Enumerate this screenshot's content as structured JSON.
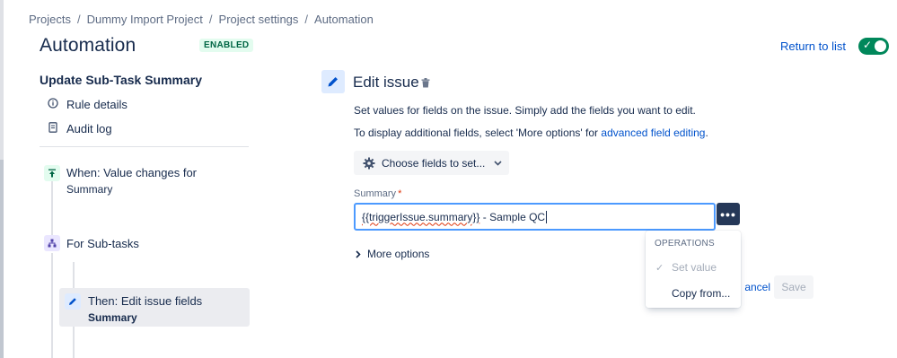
{
  "breadcrumb": {
    "items": [
      "Projects",
      "Dummy Import Project",
      "Project settings",
      "Automation"
    ],
    "separator": "/"
  },
  "header": {
    "title": "Automation",
    "status_badge": "ENABLED",
    "return_link": "Return to list",
    "toggle_on": true
  },
  "sidebar": {
    "rule_name": "Update Sub-Task Summary",
    "links": [
      {
        "label": "Rule details",
        "icon": "info-icon"
      },
      {
        "label": "Audit log",
        "icon": "document-icon"
      }
    ],
    "trigger": {
      "label": "When: Value changes for",
      "sub": "Summary"
    },
    "branch": {
      "label": "For Sub-tasks"
    },
    "action": {
      "label": "Then: Edit issue fields",
      "sub": "Summary"
    }
  },
  "editor": {
    "title": "Edit issue",
    "desc1": "Set values for fields on the issue. Simply add the fields you want to edit.",
    "desc2_prefix": "To display additional fields, select 'More options' for ",
    "desc2_link": "advanced field editing",
    "desc2_suffix": ".",
    "choose_button": "Choose fields to set...",
    "field_label": "Summary",
    "required_mark": "*",
    "field_value_smart": "{{triggerIssue.summary}}",
    "field_value_rest": " - Sample QC",
    "more_button": "•••",
    "more_options": "More options",
    "cancel": "Cancel",
    "cancel_visible": "ancel",
    "save": "Save"
  },
  "dropdown": {
    "heading": "OPERATIONS",
    "items": [
      {
        "label": "Set value",
        "selected": true
      },
      {
        "label": "Copy from...",
        "selected": false
      }
    ]
  },
  "colors": {
    "accent": "#0052cc",
    "toggle": "#00875a",
    "badge_bg": "#e3fcef",
    "badge_text": "#006644",
    "input_focus": "#4c9aff",
    "more_button_bg": "#253858"
  }
}
